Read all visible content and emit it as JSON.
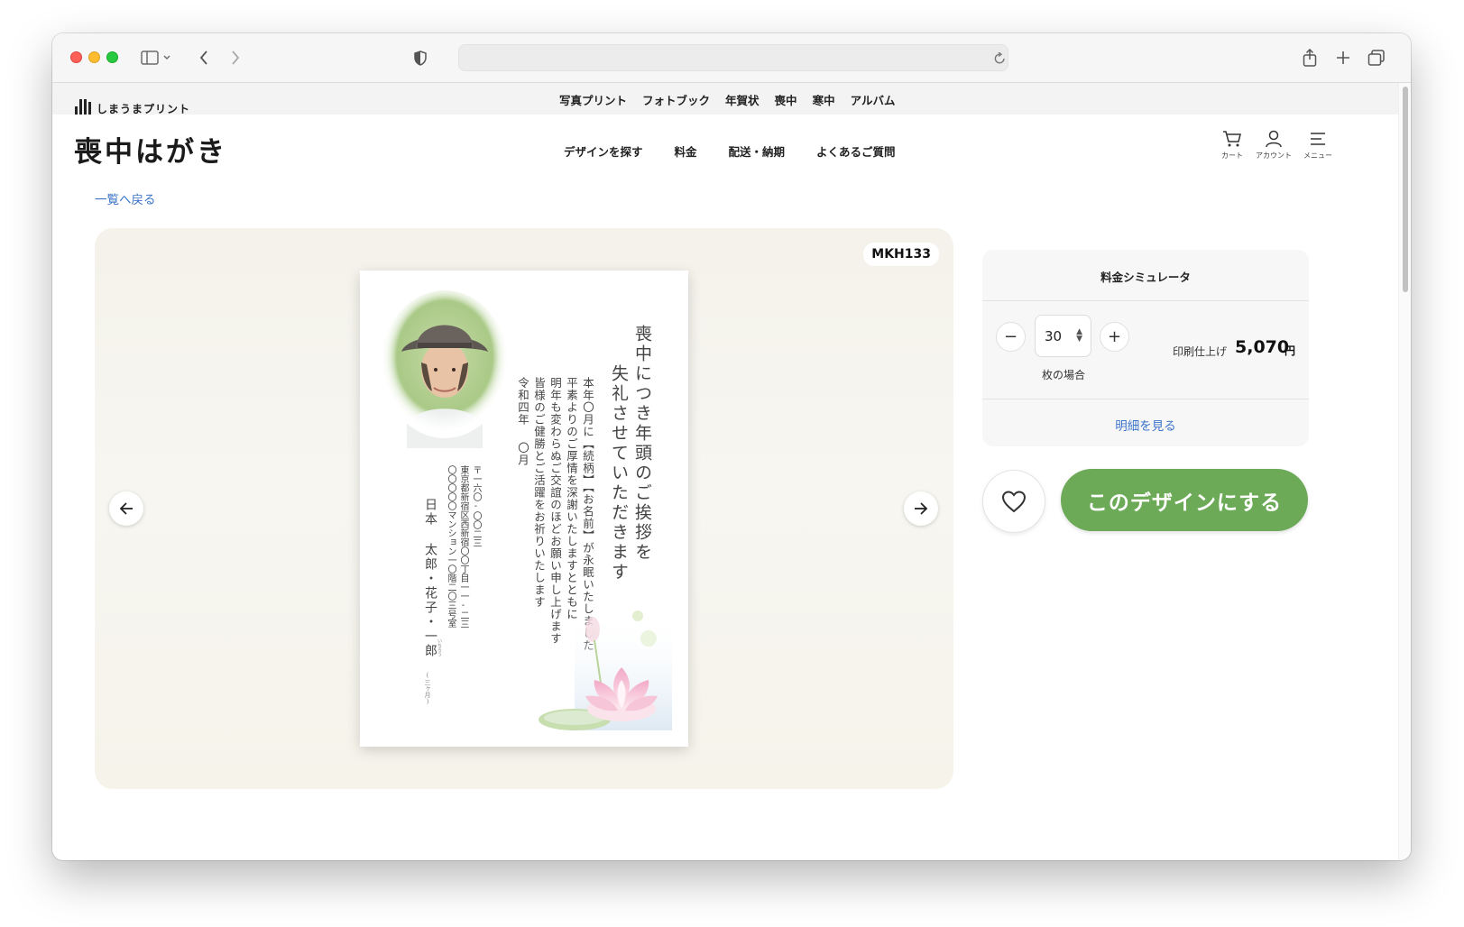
{
  "browser": {
    "url": ""
  },
  "global_nav": {
    "brand": "しまうまプリント",
    "items": [
      "写真プリント",
      "フォトブック",
      "年賀状",
      "喪中",
      "寒中",
      "アルバム"
    ]
  },
  "service": {
    "title": "喪中はがき",
    "nav": [
      "デザインを探す",
      "料金",
      "配送・納期",
      "よくあるご質問"
    ],
    "utilities": [
      {
        "label": "カート",
        "icon": "cart-icon"
      },
      {
        "label": "アカウント",
        "icon": "account-icon"
      },
      {
        "label": "メニュー",
        "icon": "menu-icon"
      }
    ]
  },
  "back_link": "一覧へ戻る",
  "design": {
    "code": "MKH133",
    "greeting": [
      "喪中につき年頭のご挨拶を",
      "失礼させていただきます"
    ],
    "body": [
      "本年〇月に【続柄】【お名前】が永眠いたしました",
      "平素よりのご厚情を深謝いたしますとともに",
      "明年も変わらぬご交誼のほどお願い申し上げます",
      "皆様のご健勝とご活躍をお祈りいたします"
    ],
    "date": [
      "令和四年",
      "〇月"
    ],
    "address": [
      "〒一六〇-〇〇二三",
      "東京都新宿区西新宿〇〇丁目一一-二三",
      "〇〇〇〇〇マンション一〇階二〇三号室"
    ],
    "names": "日本 太郎・花子・一郎",
    "ruby": "いちろう",
    "age_note": "(三ヶ月)"
  },
  "simulator": {
    "title": "料金シミュレータ",
    "quantity": "30",
    "quantity_unit": "枚の場合",
    "minus": "−",
    "plus": "+",
    "price_label": "印刷仕上げ",
    "price": "5,070",
    "price_unit": "円",
    "detail_link": "明細を見る"
  },
  "cta_label": "このデザインにする",
  "colors": {
    "accent_green": "#6caa58",
    "link_blue": "#3c74c9"
  }
}
